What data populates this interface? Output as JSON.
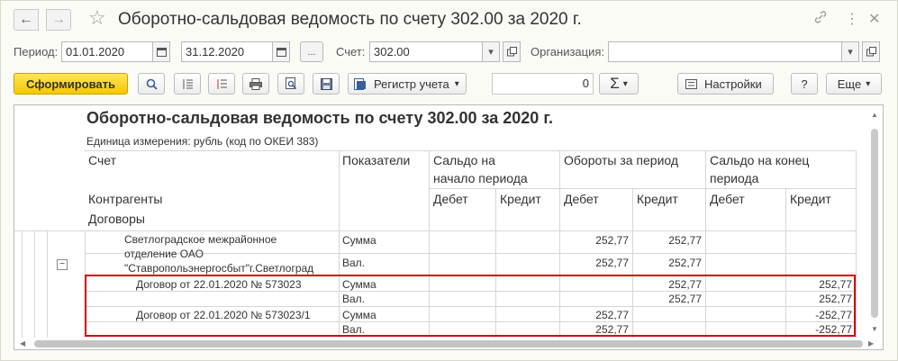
{
  "window": {
    "title": "Оборотно-сальдовая ведомость по счету 302.00 за 2020 г.",
    "back_glyph": "←",
    "forward_glyph": "→",
    "star_glyph": "☆",
    "link_glyph": "🔗",
    "menu_glyph": "⋮",
    "close_glyph": "✕"
  },
  "filters": {
    "period_label": "Период:",
    "date_from": "01.01.2020",
    "date_to": "31.12.2020",
    "dots_label": "...",
    "account_label": "Счет:",
    "account_value": "302.00",
    "org_label": "Организация:",
    "org_value": ""
  },
  "toolbar": {
    "generate_label": "Сформировать",
    "register_label": "Регистр учета",
    "amount_value": "0",
    "sum_glyph": "Σ",
    "settings_label": "Настройки",
    "help_label": "?",
    "more_label": "Еще"
  },
  "report": {
    "title": "Оборотно-сальдовая ведомость по счету 302.00 за 2020 г.",
    "unit": "Единица измерения: рубль (код по ОКЕИ 383)",
    "headers": {
      "account": "Счет",
      "contractors": "Контрагенты",
      "contracts": "Договоры",
      "indicators": "Показатели",
      "opening_line1": "Сальдо на",
      "opening_line2": "начало периода",
      "turnover": "Обороты за период",
      "closing_line1": "Сальдо на конец",
      "closing_line2": "периода",
      "debit": "Дебет",
      "credit": "Кредит"
    },
    "org": {
      "line1": "Светлоградское   межрайонное",
      "line2": "отделение ОАО",
      "line3": "\"Ставропольэнергосбыт\"г.Светлоград",
      "rows": [
        {
          "indicator": "Сумма",
          "turn_debit": "252,77",
          "turn_credit": "252,77",
          "close_debit": "",
          "close_credit": ""
        },
        {
          "indicator": "Вал.",
          "turn_debit": "252,77",
          "turn_credit": "252,77",
          "close_debit": "",
          "close_credit": ""
        }
      ]
    },
    "contracts": [
      {
        "name": "Договор от 22.01.2020 № 573023",
        "rows": [
          {
            "indicator": "Сумма",
            "turn_debit": "",
            "turn_credit": "252,77",
            "close_credit": "252,77"
          },
          {
            "indicator": "Вал.",
            "turn_debit": "",
            "turn_credit": "252,77",
            "close_credit": "252,77"
          }
        ]
      },
      {
        "name": "Договор от 22.01.2020 № 573023/1",
        "rows": [
          {
            "indicator": "Сумма",
            "turn_debit": "252,77",
            "turn_credit": "",
            "close_credit": "-252,77"
          },
          {
            "indicator": "Вал.",
            "turn_debit": "252,77",
            "turn_credit": "",
            "close_credit": "-252,77"
          }
        ]
      }
    ],
    "collapse_glyph": "−"
  }
}
